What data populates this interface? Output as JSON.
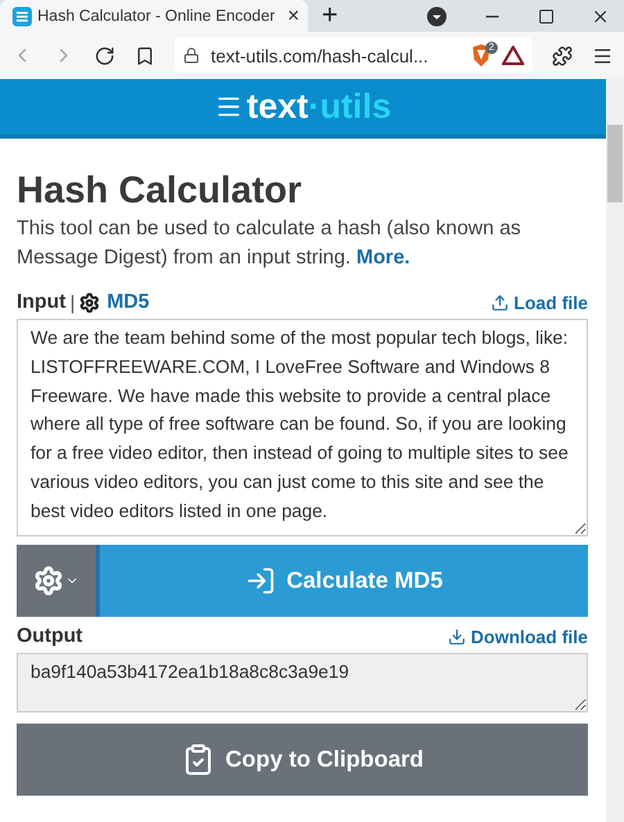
{
  "browser": {
    "tab_title": "Hash Calculator - Online Encoder",
    "tab_close": "×",
    "new_tab": "+",
    "address": "text-utils.com/hash-calcul...",
    "shield_badge": "2"
  },
  "logo": {
    "main": "text",
    "accent": "·utils"
  },
  "title": "Hash Calculator",
  "description": "This tool can be used to calculate a hash (also known as Message Digest) from an input string.",
  "more_link": "More.",
  "input": {
    "label": "Input",
    "separator": "|",
    "algorithm": "MD5",
    "load_file": "Load file",
    "value": "We are the team behind some of the most popular tech blogs, like: LISTOFFREEWARE.COM, I LoveFree Software and Windows 8 Freeware. We have made this website to provide a central place where all type of free software can be found. So, if you are looking for a free video editor, then instead of going to multiple sites to see various video editors, you can just come to this site and see the best video editors listed in one page."
  },
  "calculate_button": "Calculate MD5",
  "output": {
    "label": "Output",
    "download_file": "Download file",
    "value": "ba9f140a53b4172ea1b18a8c8c3a9e19"
  },
  "copy_button": "Copy to Clipboard"
}
